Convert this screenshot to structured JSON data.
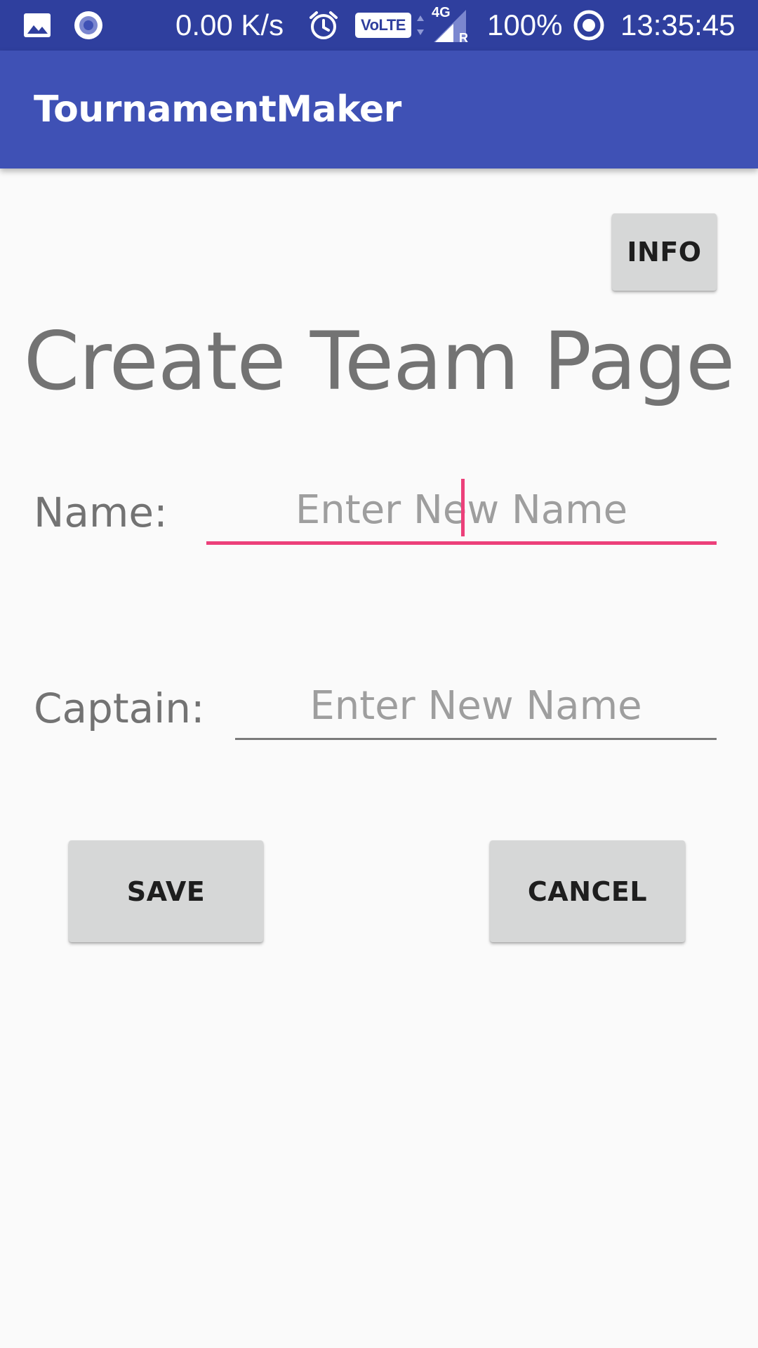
{
  "status_bar": {
    "net_speed": "0.00 K/s",
    "volte": "VoLTE",
    "network": "4G",
    "roaming": "R",
    "battery": "100%",
    "time": "13:35:45",
    "icons": [
      "image-icon",
      "record-icon",
      "alarm-icon",
      "volte-icon",
      "signal-icon",
      "sync-icon"
    ]
  },
  "app_bar": {
    "title": "TournamentMaker"
  },
  "actions": {
    "info_label": "INFO",
    "save_label": "SAVE",
    "cancel_label": "CANCEL"
  },
  "page": {
    "title": "Create Team Page"
  },
  "form": {
    "name_label": "Name:",
    "name_placeholder": "Enter New Name",
    "name_value": "",
    "captain_label": "Captain:",
    "captain_placeholder": "Enter New Name",
    "captain_value": ""
  },
  "colors": {
    "status_bar": "#2f3f9e",
    "app_bar": "#3f51b5",
    "accent": "#ec407a",
    "background": "#fafafa",
    "button": "#d6d7d7"
  }
}
